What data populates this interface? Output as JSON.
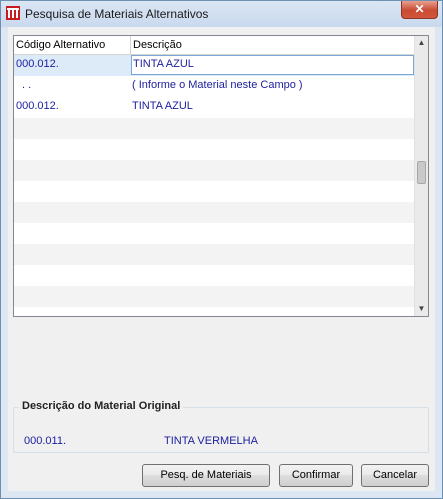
{
  "window": {
    "title": "Pesquisa de Materiais Alternativos",
    "close_label": "✕"
  },
  "grid": {
    "columns": [
      "Código Alternativo",
      "Descrição"
    ],
    "rows": [
      {
        "code": "000.012.",
        "desc": "TINTA AZUL",
        "selected": true
      },
      {
        "code": ". .",
        "desc": "( Informe o Material neste Campo )",
        "selected": false
      },
      {
        "code": "000.012.",
        "desc": "TINTA AZUL",
        "selected": false
      }
    ]
  },
  "original": {
    "legend": "Descrição do Material Original",
    "code": "000.011.",
    "desc": "TINTA VERMELHA"
  },
  "buttons": {
    "pesq": "Pesq. de Materiais",
    "confirm": "Confirmar",
    "cancel": "Cancelar"
  }
}
